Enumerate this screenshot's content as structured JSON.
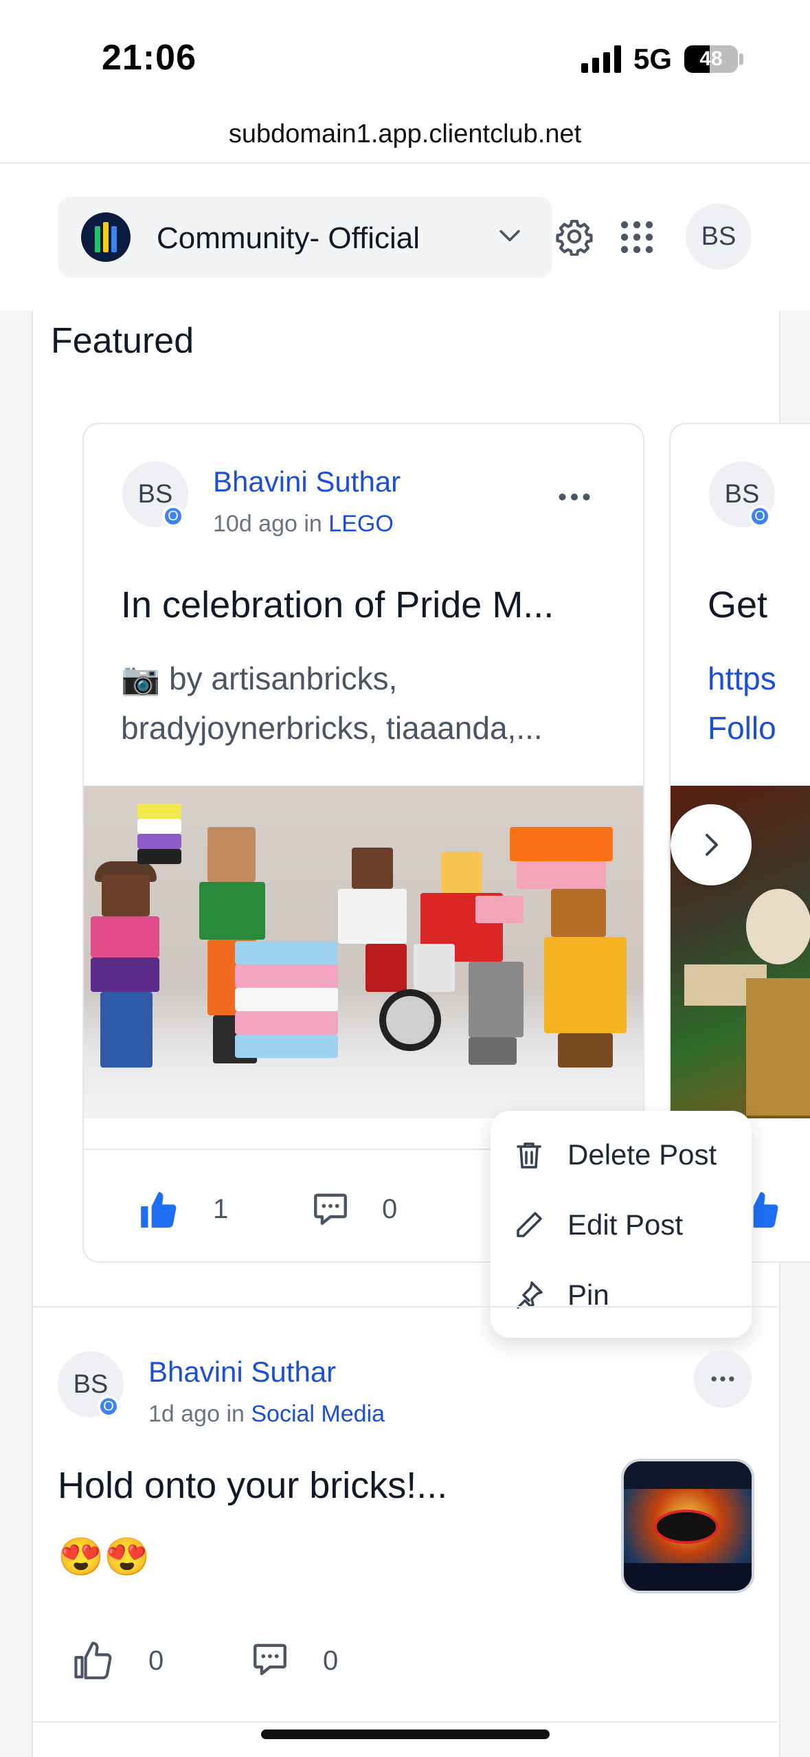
{
  "status_bar": {
    "time": "21:06",
    "network": "5G",
    "battery": "48",
    "battery_level": 0.48
  },
  "browser": {
    "url": "subdomain1.app.clientclub.net"
  },
  "nav": {
    "community_name": "Community- Official",
    "user_initials": "BS"
  },
  "featured": {
    "title": "Featured",
    "cards": [
      {
        "author_initials": "BS",
        "badge": "O",
        "author": "Bhavini Suthar",
        "time": "10d ago",
        "in_word": "in",
        "channel": "LEGO",
        "post_title": "In celebration of Pride M...",
        "body_line1": "📷 by artisanbricks,",
        "body_line2": "bradyjoynerbricks, tiaaanda,...",
        "likes": "1",
        "comments": "0"
      },
      {
        "author_initials": "BS",
        "badge": "O",
        "post_title": "Get",
        "body_line1": "https",
        "body_line2": "Follo"
      }
    ]
  },
  "post_menu": {
    "items": [
      {
        "label": "Delete Post",
        "icon": "trash-icon"
      },
      {
        "label": "Edit Post",
        "icon": "pencil-icon"
      },
      {
        "label": "Pin",
        "icon": "pin-icon"
      }
    ]
  },
  "post": {
    "author_initials": "BS",
    "badge": "O",
    "author": "Bhavini Suthar",
    "time": "1d ago",
    "in_word": "in",
    "channel": "Social Media",
    "title": "Hold onto your bricks!...",
    "emojis": "😍😍",
    "likes": "0",
    "comments": "0"
  },
  "colors": {
    "link": "#1d4ed8",
    "accent": "#3b82f6",
    "text": "#111827"
  }
}
